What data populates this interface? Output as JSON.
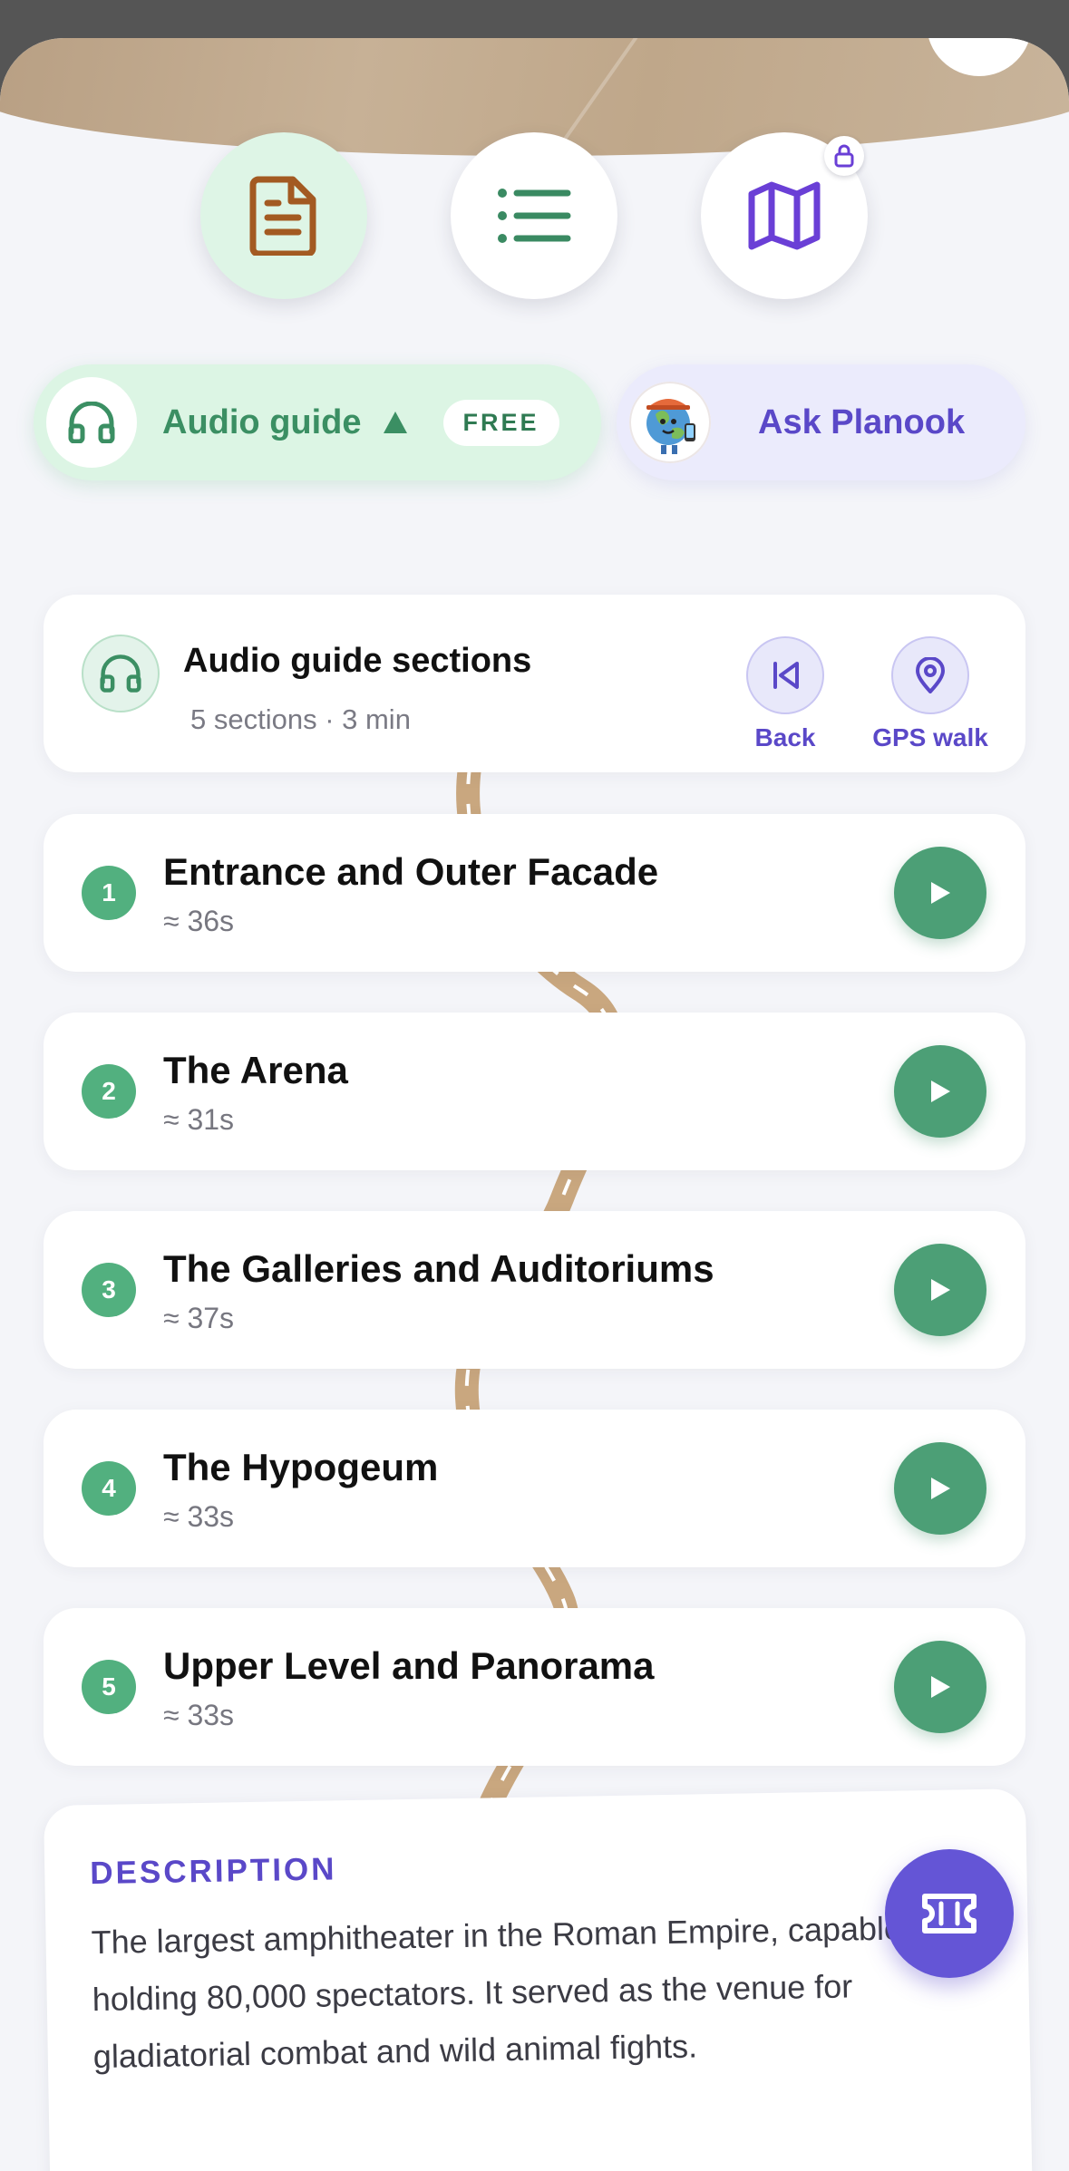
{
  "top_actions": {
    "info": {
      "icon": "document-icon",
      "color": "#a35a22"
    },
    "list": {
      "icon": "list-icon",
      "color": "#3a8a62"
    },
    "map": {
      "icon": "map-icon",
      "color": "#6a3fd6",
      "locked": true
    }
  },
  "audio_pill": {
    "label": "Audio guide",
    "badge": "FREE",
    "icon": "headphones-icon"
  },
  "ask_pill": {
    "label": "Ask Planook",
    "avatar": "planook-mascot-avatar"
  },
  "sections_header": {
    "title": "Audio guide sections",
    "meta": "5 sections · 3 min",
    "back_label": "Back",
    "gps_label": "GPS walk"
  },
  "sections": [
    {
      "num": "1",
      "title": "Entrance and Outer Facade",
      "duration": "≈ 36s"
    },
    {
      "num": "2",
      "title": "The Arena",
      "duration": "≈ 31s"
    },
    {
      "num": "3",
      "title": "The Galleries and Auditoriums",
      "duration": "≈ 37s"
    },
    {
      "num": "4",
      "title": "The Hypogeum",
      "duration": "≈ 33s"
    },
    {
      "num": "5",
      "title": "Upper Level and Panorama",
      "duration": "≈ 33s"
    }
  ],
  "description": {
    "heading": "DESCRIPTION",
    "text": "The largest amphitheater in the Roman Empire, capable of holding 80,000 spectators. It served as the venue for gladiatorial combat and wild animal fights."
  },
  "colors": {
    "accent_green": "#4c9f76",
    "accent_purple": "#5a48c8",
    "background": "#f4f5f9"
  }
}
